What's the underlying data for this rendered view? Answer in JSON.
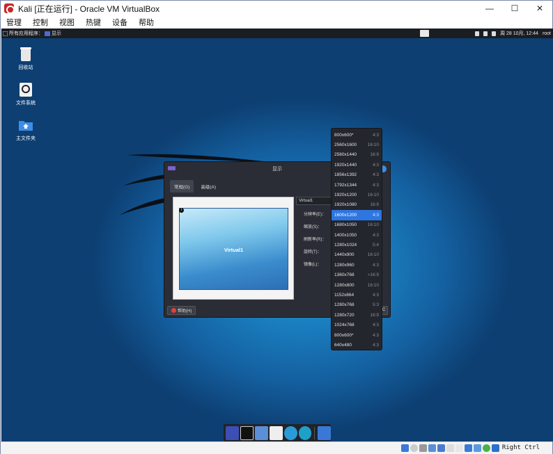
{
  "window": {
    "title": "Kali [正在运行] - Oracle VM VirtualBox",
    "controls": {
      "minimize": "—",
      "maximize": "☐",
      "close": "✕"
    }
  },
  "menubar": [
    "管理",
    "控制",
    "视图",
    "热键",
    "设备",
    "帮助"
  ],
  "panel": {
    "apps_label": "所有应用程序：",
    "active_app": "显示",
    "datetime": "周 28 10月, 12:44",
    "user": "root"
  },
  "desktop_icons": [
    {
      "label": "回收站",
      "icon": "trash-icon"
    },
    {
      "label": "文件系统",
      "icon": "drive-icon"
    },
    {
      "label": "主文件夹",
      "icon": "home-folder-icon"
    }
  ],
  "display_dialog": {
    "title": "显示",
    "tabs": [
      "常规(G)",
      "高级(A)"
    ],
    "output": "Virtual1",
    "monitor_label": "Virtual1",
    "info_icon": "i",
    "fields": [
      "分辨率(E)：",
      "缩放(S)：",
      "刷新率(R)：",
      "旋转(T)：",
      "镜像(L)："
    ],
    "help_button": "帮助(H)",
    "right_button": "C"
  },
  "resolution_menu": {
    "selected_index": 8,
    "items": [
      {
        "res": "800x600*",
        "ratio": "4:3"
      },
      {
        "res": "2560x1600",
        "ratio": "16:10"
      },
      {
        "res": "2560x1440",
        "ratio": "16:9"
      },
      {
        "res": "1920x1440",
        "ratio": "4:3"
      },
      {
        "res": "1856x1392",
        "ratio": "4:3"
      },
      {
        "res": "1792x1344",
        "ratio": "4:3"
      },
      {
        "res": "1920x1200",
        "ratio": "16:10"
      },
      {
        "res": "1920x1080",
        "ratio": "16:9"
      },
      {
        "res": "1600x1200",
        "ratio": "4:3"
      },
      {
        "res": "1680x1050",
        "ratio": "16:10"
      },
      {
        "res": "1400x1050",
        "ratio": "4:3"
      },
      {
        "res": "1280x1024",
        "ratio": "5:4"
      },
      {
        "res": "1440x900",
        "ratio": "16:10"
      },
      {
        "res": "1280x960",
        "ratio": "4:3"
      },
      {
        "res": "1360x768",
        "ratio": "≈16:9"
      },
      {
        "res": "1280x800",
        "ratio": "16:10"
      },
      {
        "res": "1152x864",
        "ratio": "4:3"
      },
      {
        "res": "1280x768",
        "ratio": "5:3"
      },
      {
        "res": "1280x720",
        "ratio": "16:9"
      },
      {
        "res": "1024x768",
        "ratio": "4:3"
      },
      {
        "res": "800x600*",
        "ratio": "4:3"
      },
      {
        "res": "640x480",
        "ratio": "4:3"
      }
    ]
  },
  "dock": [
    "show-desktop-icon",
    "terminal-icon",
    "file-manager-icon",
    "browser-icon",
    "search-icon",
    "folder-icon"
  ],
  "statusbar": {
    "host_key": "Right Ctrl"
  },
  "colors": {
    "desktop_blue": "#1a7fc0",
    "selection": "#2e76e0",
    "panel_bg": "#1a1d22"
  }
}
